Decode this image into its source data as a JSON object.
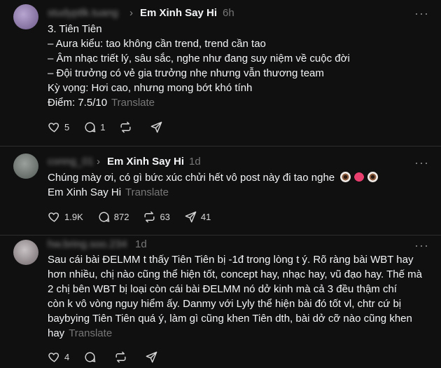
{
  "posts": [
    {
      "username": "studyptlk.tuang",
      "topic": "Em Xinh Say Hi",
      "time": "6h",
      "lines": [
        "3. Tiên Tiên",
        "– Aura kiểu: tao không cần trend, trend cần tao",
        "– Âm nhạc triết lý, sâu sắc, nghe như đang suy niệm về cuộc đời",
        "– Đội trưởng có vẻ gia trưởng nhẹ nhưng vẫn thương team",
        "Kỳ vọng: Hơi cao, nhưng mong bớt khó tính"
      ],
      "last_line": "Điểm: 7.5/10",
      "translate": "Translate",
      "likes": "5",
      "replies": "1",
      "reposts": "",
      "shares": ""
    },
    {
      "username": "conng_01",
      "topic": "Em Xinh Say Hi",
      "time": "1d",
      "lines": [
        "Chúng mày ơi, có gì bức xúc chửi hết vô post này đi tao nghe"
      ],
      "last_line": "Em Xinh Say Hi",
      "translate": "Translate",
      "likes": "1.9K",
      "replies": "872",
      "reposts": "63",
      "shares": "41"
    },
    {
      "username": "hw.bring.soo.234",
      "topic": "",
      "time": "1d",
      "lines": [
        "Sau cái bài ĐELMM t thấy Tiên Tiên bị -1đ trong lòng t ý. Rõ ràng bài WBT hay",
        "hơn nhiều, chị nào cũng thể hiện tốt, concept hay, nhạc hay, vũ đạo hay. Thế mà",
        "2 chị bên WBT bị loại còn cái bài ĐELMM nó dở kinh mà cả 3 đều thậm chí",
        "còn k vô vòng nguy hiểm ấy. Danmy với Lyly thể hiện bài đó tốt vl, chtr cứ bị",
        "baybying Tiên Tiên quá ý, làm gì cũng khen Tiên dth, bài dở cỡ nào cũng khen"
      ],
      "last_line": "hay",
      "translate": "Translate",
      "likes": "4",
      "replies": "",
      "reposts": "",
      "shares": ""
    }
  ],
  "colors": {
    "background": "#101010",
    "text": "#f3f5f7",
    "muted": "#777777",
    "divider": "#2e2e2e"
  },
  "icons": [
    "heart-icon",
    "comment-icon",
    "repost-icon",
    "share-icon",
    "more-icon",
    "arrow-icon"
  ]
}
